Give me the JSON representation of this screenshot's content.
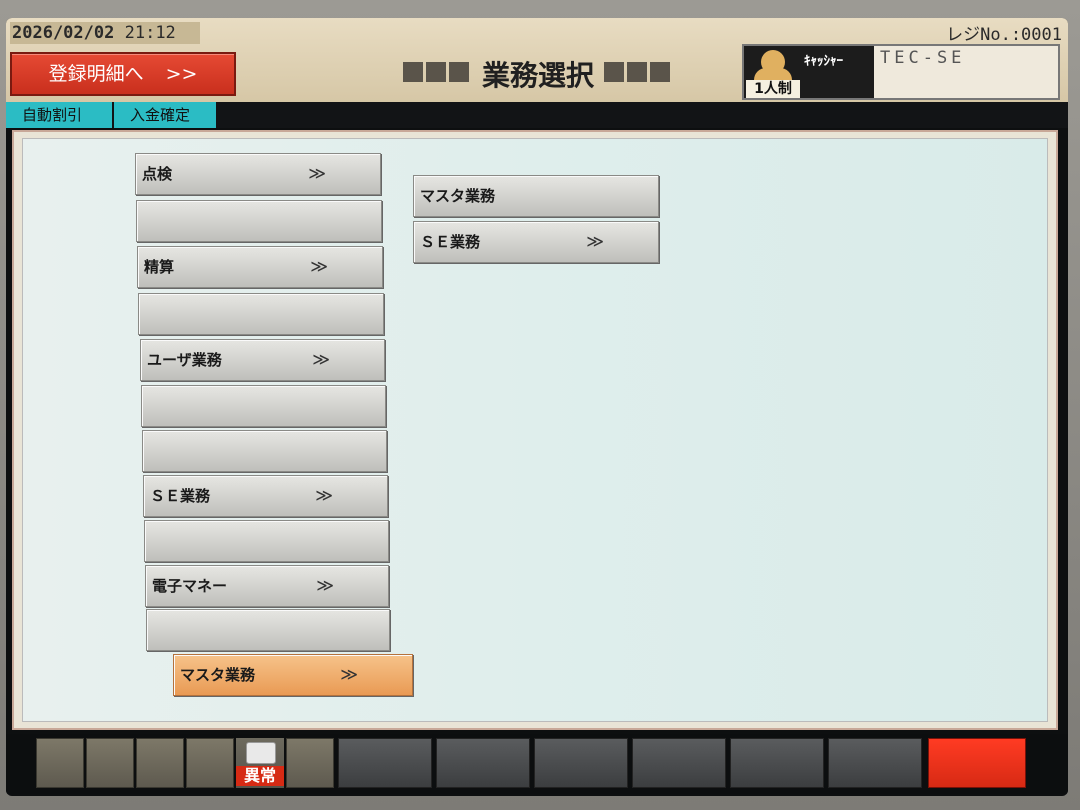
{
  "header": {
    "date": "2026/02/02",
    "time": "21:12",
    "register_detail_label": "登録明細へ",
    "register_detail_arrow": ">>",
    "title": "業務選択",
    "register_no": "レジNo.:0001",
    "cashier_mode": "1人制",
    "cashier_label": "ｷｬｯｼｬｰ",
    "cashier_name": "TEC-SE"
  },
  "tabs": [
    {
      "label": "自動割引"
    },
    {
      "label": "入金確定"
    }
  ],
  "left_menu": [
    {
      "label": "点検",
      "chevron": "≫"
    },
    {
      "label": "",
      "chevron": ""
    },
    {
      "label": "精算",
      "chevron": "≫"
    },
    {
      "label": "",
      "chevron": ""
    },
    {
      "label": "ユーザ業務",
      "chevron": "≫"
    },
    {
      "label": "",
      "chevron": ""
    },
    {
      "label": "",
      "chevron": ""
    },
    {
      "label": "ＳＥ業務",
      "chevron": "≫"
    },
    {
      "label": "",
      "chevron": ""
    },
    {
      "label": "電子マネー",
      "chevron": "≫"
    },
    {
      "label": "",
      "chevron": ""
    }
  ],
  "selected_item": {
    "label": "マスタ業務",
    "chevron": "≫"
  },
  "sub_menu": [
    {
      "label": "マスタ業務",
      "chevron": ""
    },
    {
      "label": "ＳＥ業務",
      "chevron": "≫"
    }
  ],
  "footer": {
    "alarm_label": "異常"
  },
  "colors": {
    "accent_red": "#d72a14",
    "tab_cyan": "#2bbcc4",
    "selected_orange": "#e99a54"
  }
}
